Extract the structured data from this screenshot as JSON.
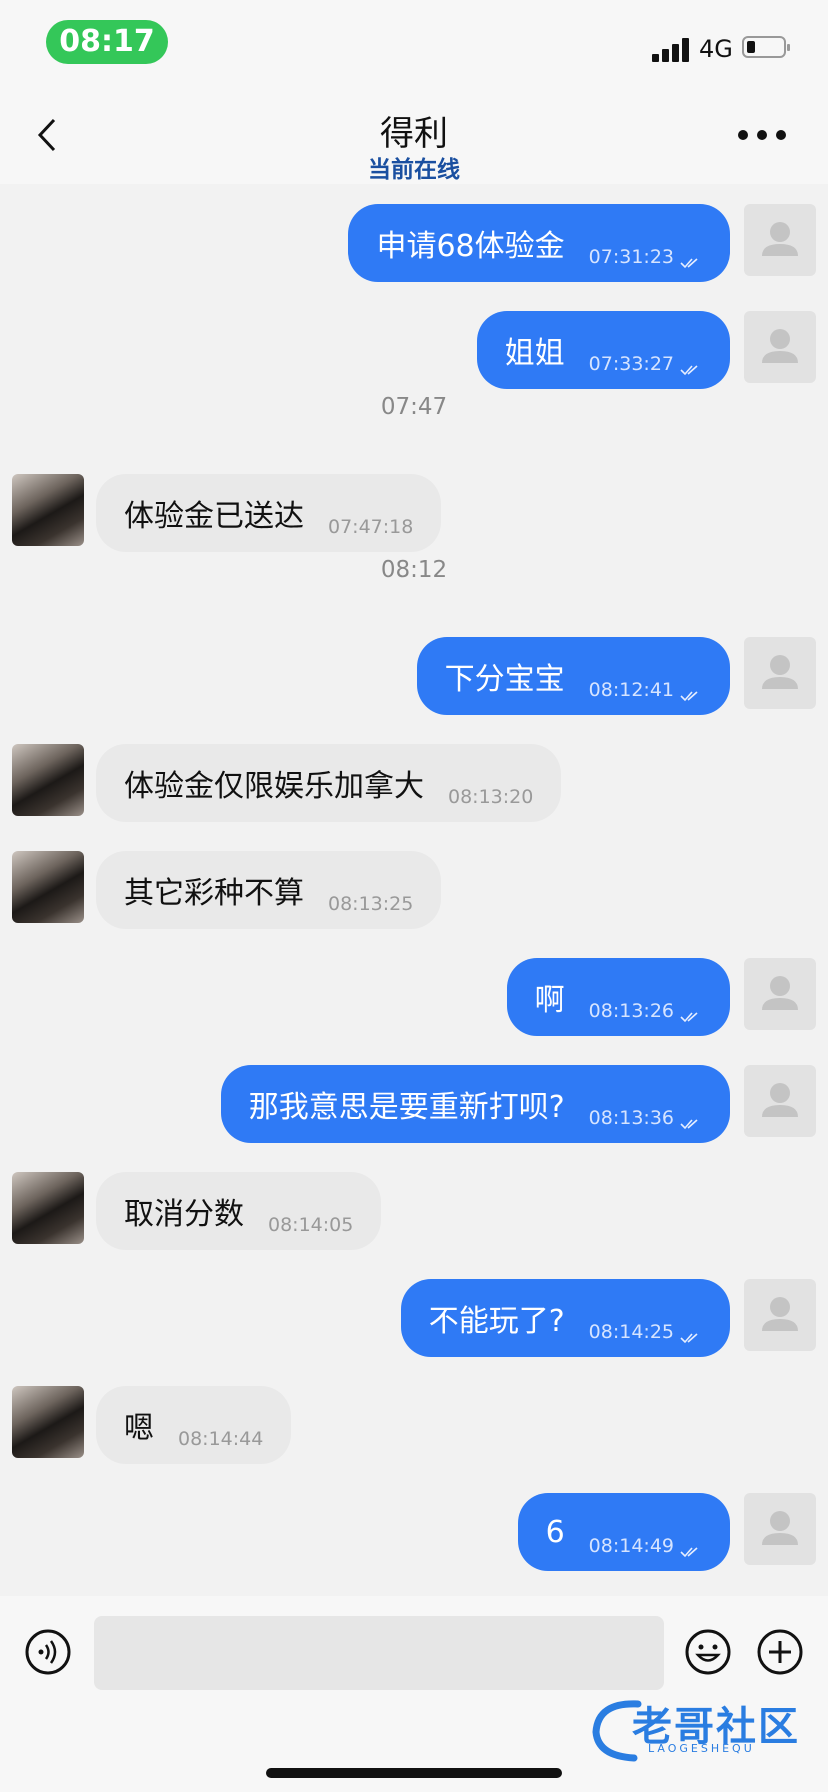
{
  "status_bar": {
    "time": "08:17",
    "network": "4G"
  },
  "header": {
    "title": "得利",
    "subtitle": "当前在线"
  },
  "messages": [
    {
      "dir": "out",
      "text": "申请68体验金",
      "time": "07:31:23"
    },
    {
      "dir": "out",
      "text": "姐姐",
      "time": "07:33:27"
    },
    {
      "divider": "07:47"
    },
    {
      "dir": "in",
      "text": "体验金已送达",
      "time": "07:47:18"
    },
    {
      "divider": "08:12"
    },
    {
      "dir": "out",
      "text": "下分宝宝",
      "time": "08:12:41"
    },
    {
      "dir": "in",
      "text": "体验金仅限娱乐加拿大",
      "time": "08:13:20"
    },
    {
      "dir": "in",
      "text": "其它彩种不算",
      "time": "08:13:25"
    },
    {
      "dir": "out",
      "text": "啊",
      "time": "08:13:26"
    },
    {
      "dir": "out",
      "text": "那我意思是要重新打呗?",
      "time": "08:13:36"
    },
    {
      "dir": "in",
      "text": "取消分数",
      "time": "08:14:05"
    },
    {
      "dir": "out",
      "text": "不能玩了?",
      "time": "08:14:25"
    },
    {
      "dir": "in",
      "text": "嗯",
      "time": "08:14:44"
    },
    {
      "dir": "out",
      "text": "6",
      "time": "08:14:49"
    }
  ],
  "input": {
    "placeholder": ""
  },
  "watermark": {
    "text": "老哥社区",
    "sub": "LAOGESHEQU"
  },
  "colors": {
    "outgoing_bubble": "#2f7af5",
    "incoming_bubble": "#e9e9e9",
    "online_status": "#1a4fa0",
    "status_time_pill": "#34c759"
  }
}
